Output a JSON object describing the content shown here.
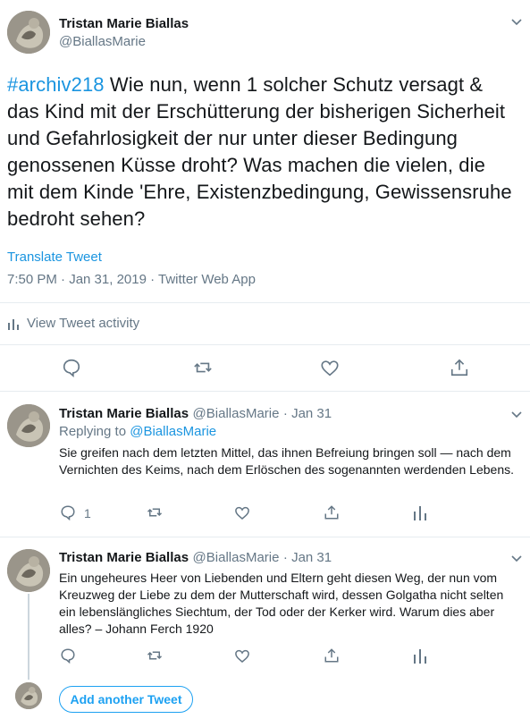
{
  "main_tweet": {
    "author_name": "Tristan Marie Biallas",
    "author_handle": "@BiallasMarie",
    "hashtag": "#archiv218",
    "text": " Wie nun, wenn 1 solcher Schutz versagt & das Kind mit der Erschütterung der bisherigen Sicherheit und Gefahrlosigkeit der nur unter dieser Bedingung genossenen Küsse droht? Was machen die vielen, die mit dem Kinde 'Ehre, Existenzbedingung, Gewissensruhe bedroht sehen?",
    "translate_label": "Translate Tweet",
    "timestamp": "7:50 PM · Jan 31, 2019 · Twitter Web App",
    "activity_label": "View Tweet activity"
  },
  "replies": [
    {
      "author_name": "Tristan Marie Biallas",
      "author_handle": "@BiallasMarie",
      "date": "· Jan 31",
      "replying_prefix": "Replying to ",
      "replying_handle": "@BiallasMarie",
      "text": "Sie greifen nach dem letzten Mittel, das ihnen Befreiung bringen soll — nach dem Vernichten des Keims, nach dem Erlöschen des sogenannten werdenden Lebens.",
      "reply_count": "1"
    },
    {
      "author_name": "Tristan Marie Biallas",
      "author_handle": "@BiallasMarie",
      "date": "· Jan 31",
      "text": "Ein ungeheures Heer von Liebenden und Eltern geht diesen Weg, der nun vom Kreuzweg der Liebe zu dem der Mutterschaft wird, dessen Golgatha nicht selten ein lebenslängliches Siechtum, der Tod oder der Kerker wird. Warum dies aber alles? – Johann Ferch 1920",
      "reply_count": ""
    }
  ],
  "composer": {
    "add_button_label": "Add another Tweet"
  },
  "colors": {
    "accent": "#1da1f2",
    "link": "#1b95e0",
    "muted": "#657786",
    "divider": "#e6ecf0"
  }
}
